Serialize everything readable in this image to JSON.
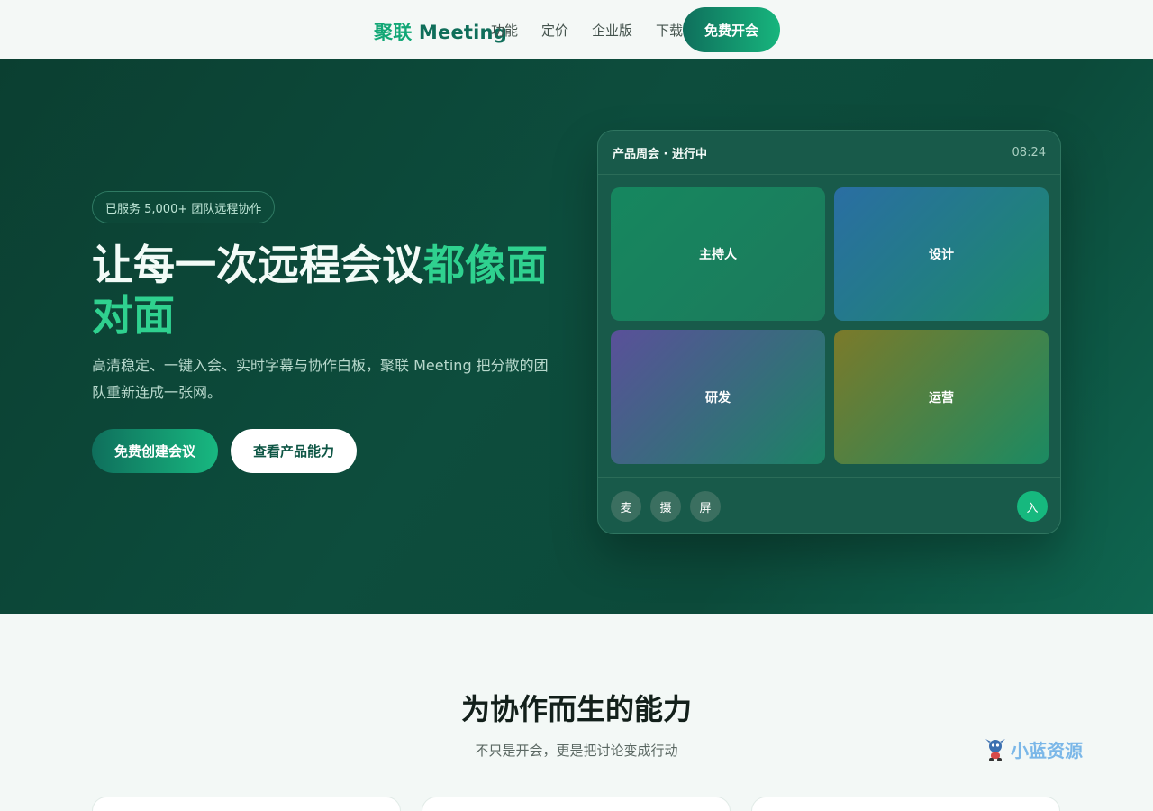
{
  "nav": {
    "brand_cn": "聚联",
    "brand_en": "Meeting",
    "links": [
      "功能",
      "定价",
      "企业版",
      "下载"
    ],
    "cta": "免费开会"
  },
  "hero": {
    "badge": "已服务 5,000+ 团队远程协作",
    "title_main": "让每一次远程会议",
    "title_accent": "都像面对面",
    "subtitle": "高清稳定、一键入会、实时字幕与协作白板，聚联 Meeting 把分散的团队重新连成一张网。",
    "primary_button": "免费创建会议",
    "secondary_button": "查看产品能力"
  },
  "meeting_card": {
    "title": "产品周会 · 进行中",
    "time": "08:24",
    "tiles": [
      "主持人",
      "设计",
      "研发",
      "运营"
    ],
    "controls": [
      "麦",
      "摄",
      "屏"
    ],
    "join": "入"
  },
  "features": {
    "title": "为协作而生的能力",
    "subtitle": "不只是开会，更是把讨论变成行动"
  },
  "watermark": {
    "text": "小蓝资源"
  },
  "colors": {
    "brand": "#0f6e5a",
    "accent": "#2fd18f",
    "hero_bg": "#0c4a3a"
  }
}
